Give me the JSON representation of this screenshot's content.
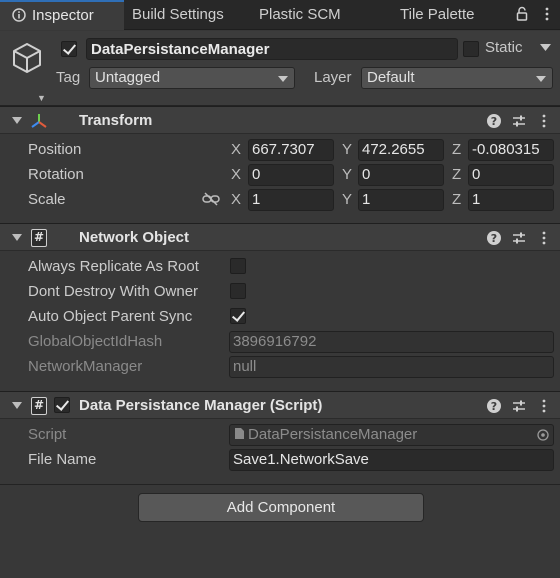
{
  "tabs": [
    {
      "label": "Inspector",
      "active": true
    },
    {
      "label": "Build Settings",
      "active": false
    },
    {
      "label": "Plastic SCM",
      "active": false
    },
    {
      "label": "Tile Palette",
      "active": false
    }
  ],
  "header": {
    "active_checked": true,
    "object_name": "DataPersistanceManager",
    "static_label": "Static",
    "static_checked": false,
    "tag_label": "Tag",
    "tag_value": "Untagged",
    "layer_label": "Layer",
    "layer_value": "Default"
  },
  "transform": {
    "title": "Transform",
    "position": {
      "label": "Position",
      "x": "667.7307",
      "y": "472.2655",
      "z": "-0.080315"
    },
    "rotation": {
      "label": "Rotation",
      "x": "0",
      "y": "0",
      "z": "0"
    },
    "scale": {
      "label": "Scale",
      "x": "1",
      "y": "1",
      "z": "1"
    },
    "axis_x": "X",
    "axis_y": "Y",
    "axis_z": "Z"
  },
  "network_object": {
    "title": "Network Object",
    "always_replicate_label": "Always Replicate As Root",
    "always_replicate_checked": false,
    "dont_destroy_label": "Dont Destroy With Owner",
    "dont_destroy_checked": false,
    "auto_parent_label": "Auto Object Parent Sync",
    "auto_parent_checked": true,
    "hash_label": "GlobalObjectIdHash",
    "hash_value": "3896916792",
    "manager_label": "NetworkManager",
    "manager_value": "null"
  },
  "script_component": {
    "title": "Data Persistance Manager (Script)",
    "enabled": true,
    "script_label": "Script",
    "script_value": "DataPersistanceManager",
    "file_name_label": "File Name",
    "file_name_value": "Save1.NetworkSave"
  },
  "add_component_label": "Add Component",
  "colors": {
    "panel": "#383838",
    "tabbar": "#282828",
    "header": "#3c3c3c",
    "field": "#2a2a2a",
    "accent": "#2f6fb7"
  }
}
